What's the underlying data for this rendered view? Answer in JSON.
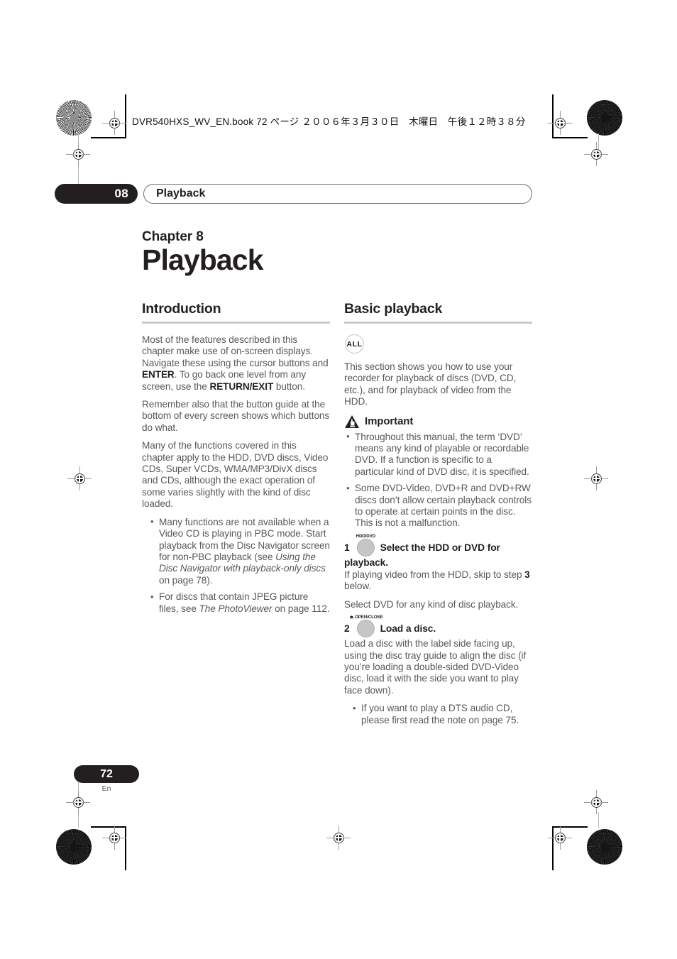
{
  "print_header": {
    "book_line": "DVR540HXS_WV_EN.book  72 ページ  ２００６年３月３０日　木曜日　午後１２時３８分"
  },
  "chapter_bar": {
    "number": "08",
    "title": "Playback"
  },
  "title_block": {
    "chapter_label": "Chapter 8",
    "chapter_title": "Playback"
  },
  "left_column": {
    "heading": "Introduction",
    "paragraphs": {
      "p1_part1": "Most of the features described in this chapter make use of on-screen displays. Navigate these using the cursor buttons and ",
      "p1_bold1": "ENTER",
      "p1_part2": ". To go back one level from any screen, use the ",
      "p1_bold2": "RETURN/EXIT",
      "p1_part3": " button.",
      "p2": "Remember also that the button guide at the bottom of every screen shows which buttons do what.",
      "p3": "Many of the functions covered in this chapter apply to the HDD, DVD discs, Video CDs, Super VCDs, WMA/MP3/DivX discs and CDs, although the exact operation of some varies slightly with the kind of disc loaded."
    },
    "bullets": [
      {
        "part1": "Many functions are not available when a Video CD is playing in PBC mode. Start playback from the Disc Navigator screen for non-PBC playback (see ",
        "italic": "Using the Disc Navigator with playback-only discs",
        "part2": " on page 78)."
      },
      {
        "part1": "For discs that contain JPEG picture files, see ",
        "italic": "The PhotoViewer",
        "part2": " on page 112."
      }
    ]
  },
  "right_column": {
    "heading": "Basic playback",
    "all_icon_label": "ALL",
    "intro": "This section shows you how to use your recorder for playback of discs (DVD, CD, etc.), and for playback of video from the HDD.",
    "important": {
      "label": "Important",
      "bullets": [
        "Throughout this manual, the term ‘DVD’ means any kind of playable or recordable DVD. If a function is specific to a particular kind of DVD disc, it is specified.",
        "Some DVD-Video, DVD+R and DVD+RW discs don’t allow certain playback controls to operate at certain points in the disc. This is not a malfunction."
      ]
    },
    "steps": [
      {
        "number": "1",
        "button_caption": "HDD/DVD",
        "title": "Select the HDD or DVD for playback.",
        "body_part1": "If playing video from the HDD, skip to step ",
        "body_bold": "3",
        "body_part2": " below.",
        "body2": "Select DVD for any kind of disc playback."
      },
      {
        "number": "2",
        "button_caption": "⏏ OPEN/CLOSE",
        "title": "Load a disc.",
        "body": "Load a disc with the label side facing up, using the disc tray guide to align the disc (if you’re loading a double-sided DVD-Video disc, load it with the side you want to play face down).",
        "bullets": [
          "If you want to play a DTS audio CD, please first read the note on page 75."
        ]
      }
    ]
  },
  "footer": {
    "page_number": "72",
    "language": "En"
  }
}
